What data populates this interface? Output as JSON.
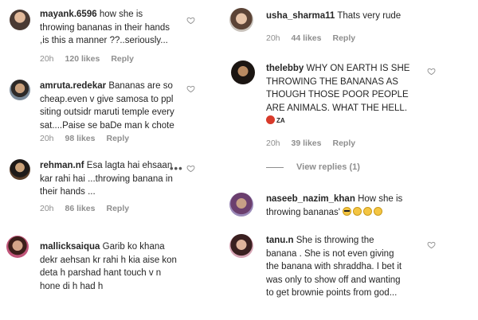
{
  "comments": [
    {
      "username": "mayank.6596",
      "lines": [
        "how she is",
        "throwing bananas in their hands",
        ",is this a manner ??..seriously..."
      ],
      "time": "20h",
      "likes": "120 likes",
      "reply": "Reply"
    },
    {
      "username": "amruta.redekar",
      "lines": [
        "Bananas are so",
        "cheap.even v give samosa to ppl",
        "siting outsidr maruti temple every",
        "sat....Paise se baDe man k chote"
      ],
      "time": "20h",
      "likes": "98 likes",
      "reply": "Reply"
    },
    {
      "username": "rehman.nf",
      "lines": [
        "Esa lagta hai ehsaan",
        "kar rahi hai ...throwing banana in",
        "their hands ..."
      ],
      "time": "20h",
      "likes": "86 likes",
      "reply": "Reply"
    },
    {
      "username": "mallicksaiqua",
      "lines": [
        "Garib ko khana",
        "dekr aehsan kr rahi h kia aise kon",
        "deta h parshad hant touch v n",
        "hone di h had h"
      ]
    },
    {
      "username": "usha_sharma11",
      "lines": [
        "Thats very rude"
      ],
      "time": "20h",
      "likes": "44 likes",
      "reply": "Reply"
    },
    {
      "username": "thelebby",
      "lines": [
        "WHY ON EARTH IS SHE",
        "THROWING THE BANANAS AS",
        "THOUGH THOSE POOR PEOPLE",
        "ARE ANIMALS. WHAT THE HELL."
      ],
      "badge": "ZA",
      "time": "20h",
      "likes": "39 likes",
      "reply": "Reply",
      "view_replies": "View replies (1)"
    },
    {
      "username": "naseeb_nazim_khan",
      "lines": [
        "How she is",
        "throwing bananas'"
      ]
    },
    {
      "username": "tanu.n",
      "lines": [
        "She is throwing the",
        "banana . She is not even giving",
        "the banana with shraddha. I bet it",
        "was only to show off and wanting",
        "to get brownie points from god..."
      ]
    }
  ],
  "icons": {
    "heart": "heart-icon",
    "more": "more-options-icon",
    "angry_emoji": "angry-face-emoji",
    "cool_emoji": "sunglasses-face-emoji",
    "smirk_emoji": "smirking-face-emoji"
  },
  "colors": {
    "text": "#262626",
    "muted": "#8e8e8e",
    "background": "#ffffff"
  }
}
